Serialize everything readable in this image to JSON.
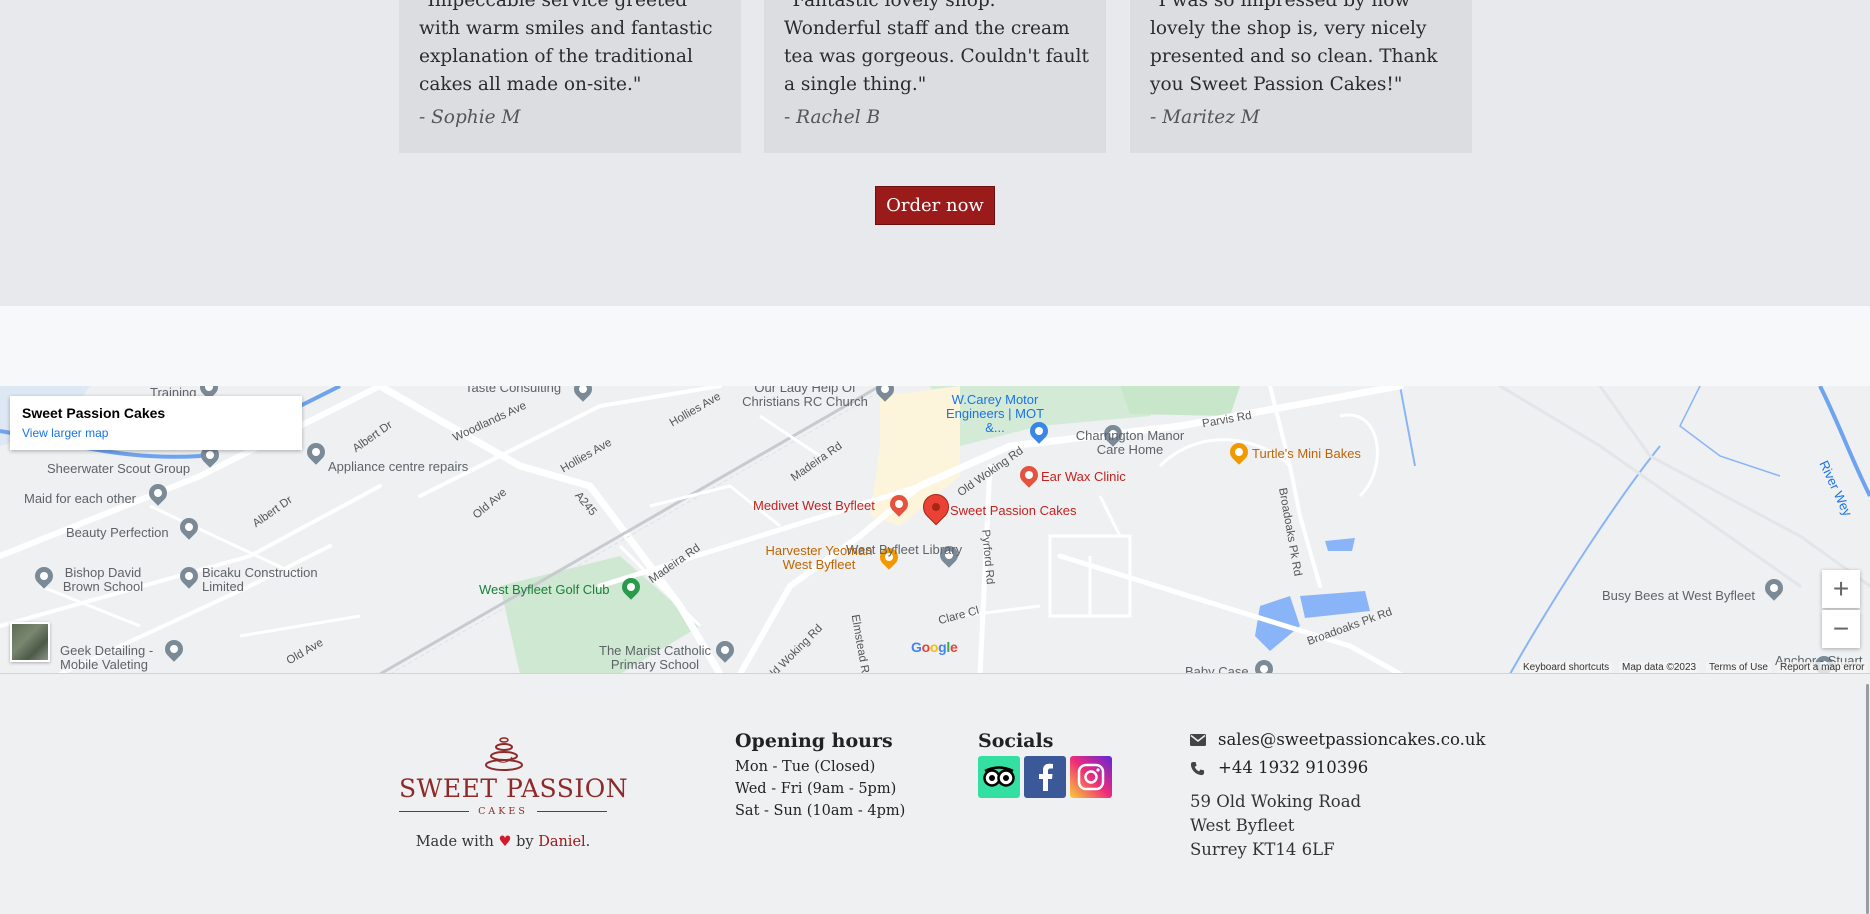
{
  "testimonials": [
    {
      "quote": "\"Impeccable service greeted with warm smiles and fantastic explanation of the traditional cakes all made on-site.\"",
      "author": "- Sophie M"
    },
    {
      "quote": "\"Fantastic lovely shop. Wonderful staff and the cream tea was gorgeous. Couldn't fault a single thing.\"",
      "author": "- Rachel B"
    },
    {
      "quote": "\"I was so impressed by how lovely the shop is, very nicely presented and so clean. Thank you Sweet Passion Cakes!\"",
      "author": "- Maritez M"
    }
  ],
  "order_button": "Order now",
  "map": {
    "info_title": "Sweet Passion Cakes",
    "info_link": "View larger map",
    "zoom_in": "+",
    "zoom_out": "−",
    "google": "Google",
    "attribution": {
      "shortcuts": "Keyboard shortcuts",
      "data": "Map data ©2023",
      "terms": "Terms of Use",
      "report": "Report a map error"
    },
    "places": {
      "main": "Sweet Passion Cakes",
      "medivet": "Medivet West Byfleet",
      "earwax": "Ear Wax Clinic",
      "turtle": "Turtle's Mini Bakes",
      "harvester": "Harvester Yeoman West Byfleet",
      "library": "West Byfleet Library",
      "golf": "West Byfleet Golf Club",
      "marist": "The Marist Catholic Primary School",
      "charrington": "Charrington Manor Care Home",
      "wcarey": "W.Carey Motor Engineers | MOT &...",
      "ourlady": "Our Lady Help Of Christians RC Church",
      "taste": "Taste Consulting",
      "training": "Training",
      "sheerwater": "Sheerwater Scout Group",
      "appliance": "Appliance centre repairs",
      "maid": "Maid for each other",
      "beauty": "Beauty Perfection",
      "bishop": "Bishop David Brown School",
      "bicaku": "Bicaku Construction Limited",
      "geek": "Geek Detailing - Mobile Valeting",
      "busybees": "Busy Bees at West Byfleet",
      "babycase": "Baby Case",
      "anchor": "Anchor - Stuart",
      "river": "River Wey"
    },
    "roads": {
      "albert1": "Albert Dr",
      "albert2": "Albert Dr",
      "woodlands": "Woodlands Ave",
      "hollies1": "Hollies Ave",
      "hollies2": "Hollies Ave",
      "oldave1": "Old Ave",
      "oldave2": "Old Ave",
      "a245": "A245",
      "madeira1": "Madeira Rd",
      "madeira2": "Madeira Rd",
      "oldwoking1": "Old Woking Rd",
      "oldwoking2": "Old Woking Rd",
      "parvis": "Parvis Rd",
      "pyrford": "Pyrford Rd",
      "clare": "Clare Cl",
      "elmstead": "Elmstead R",
      "broadoaks1": "Broadoaks Pk Rd",
      "broadoaks2": "Broadoaks Pk Rd"
    }
  },
  "footer": {
    "logo_name": "SWEET PASSION",
    "logo_sub": "CAKES",
    "made_with_prefix": "Made with",
    "made_with_by": "by",
    "made_with_author": "Daniel",
    "made_with_suffix": ".",
    "hours_title": "Opening hours",
    "hours": [
      "Mon - Tue (Closed)",
      "Wed - Fri (9am - 5pm)",
      "Sat - Sun (10am - 4pm)"
    ],
    "socials_title": "Socials",
    "socials": [
      "tripadvisor-icon",
      "facebook-icon",
      "instagram-icon"
    ],
    "email": "sales@sweetpassioncakes.co.uk",
    "phone": "+44 1932 910396",
    "address": [
      "59 Old Woking Road",
      "West Byfleet",
      "Surrey KT14 6LF"
    ]
  },
  "colors": {
    "accent": "#9b1b1b",
    "brand": "#8e2a2a"
  }
}
